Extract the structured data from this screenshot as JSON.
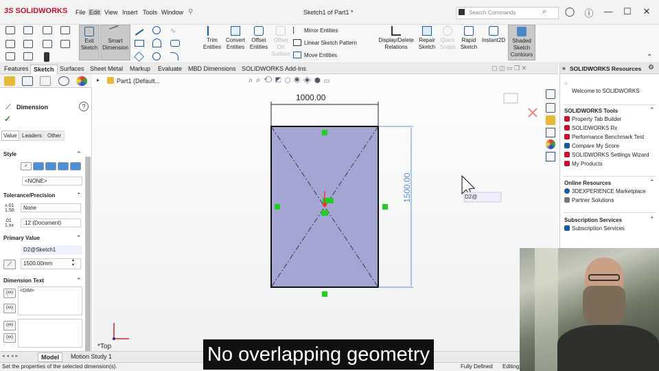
{
  "app": {
    "name": "SOLIDWORKS",
    "ds": "3S",
    "document_title": "Sketch1 of Part1 *"
  },
  "menu": [
    "File",
    "Edit",
    "View",
    "Insert",
    "Tools",
    "Window"
  ],
  "search": {
    "placeholder": "Search Commands"
  },
  "ribbon": {
    "exit_sketch": "Exit Sketch",
    "smart_dimension": "Smart Dimension",
    "trim": "Trim Entities",
    "convert": "Convert Entities",
    "offset": "Offset Entities",
    "offset_surface": "Offset On Surface",
    "mirror": "Mirror Entities",
    "linear_pattern": "Linear Sketch Pattern",
    "move": "Move Entities",
    "display_delete": "Display/Delete Relations",
    "repair": "Repair Sketch",
    "quick_snaps": "Quick Snaps",
    "rapid_sketch": "Rapid Sketch",
    "instant2d": "Instant2D",
    "shaded_contours": "Shaded Sketch Contours"
  },
  "tabs": [
    "Features",
    "Sketch",
    "Surfaces",
    "Sheet Metal",
    "Markup",
    "Evaluate",
    "MBD Dimensions",
    "SOLIDWORKS Add-Ins"
  ],
  "active_tab": "Sketch",
  "property_manager": {
    "title": "Dimension",
    "subtabs": [
      "Value",
      "Leaders",
      "Other"
    ],
    "style": {
      "label": "Style",
      "dropdown": "<NONE>"
    },
    "tolerance": {
      "label": "Tolerance/Precision",
      "type": "None",
      "precision": ".12 (Document)"
    },
    "primary_value": {
      "label": "Primary Value",
      "name": "D2@Sketch1",
      "value": "1500.00mm"
    },
    "dimension_text": {
      "label": "Dimension Text",
      "text": "<DIM>",
      "btn1": "(xx)",
      "btn2": "(xx)",
      "btn3": "(xx)",
      "btn4": "(xx)"
    }
  },
  "tree": {
    "item": "Part1 (Default..."
  },
  "sketch": {
    "width_dim": "1000.00",
    "height_dim": "1500.00",
    "view_label": "*Top",
    "cursor_text": "D2@"
  },
  "resources": {
    "title": "SOLIDWORKS Resources",
    "welcome": "Welcome to SOLIDWORKS",
    "tools_header": "SOLIDWORKS Tools",
    "tools": [
      "Property Tab Builder",
      "SOLIDWORKS Rx",
      "Performance Benchmark Test",
      "Compare My Score",
      "SOLIDWORKS Settings Wizard",
      "My Products"
    ],
    "online_header": "Online Resources",
    "online": [
      "3DEXPERIENCE Marketplace",
      "Partner Solutions"
    ],
    "sub_header": "Subscription Services",
    "sub": [
      "Subscription Services"
    ]
  },
  "bottom_tabs": [
    "Model",
    "Motion Study 1"
  ],
  "status": {
    "message": "Set the properties of the selected dimension(s).",
    "fully_defined": "Fully Defined",
    "editing": "Editing"
  },
  "caption": "No overlapping geometry",
  "colors": {
    "sketch_fill": "#a6a6d4",
    "dim_blue": "#5a8fd6",
    "relation_green": "#22cc22",
    "brand_red": "#c8102e"
  }
}
